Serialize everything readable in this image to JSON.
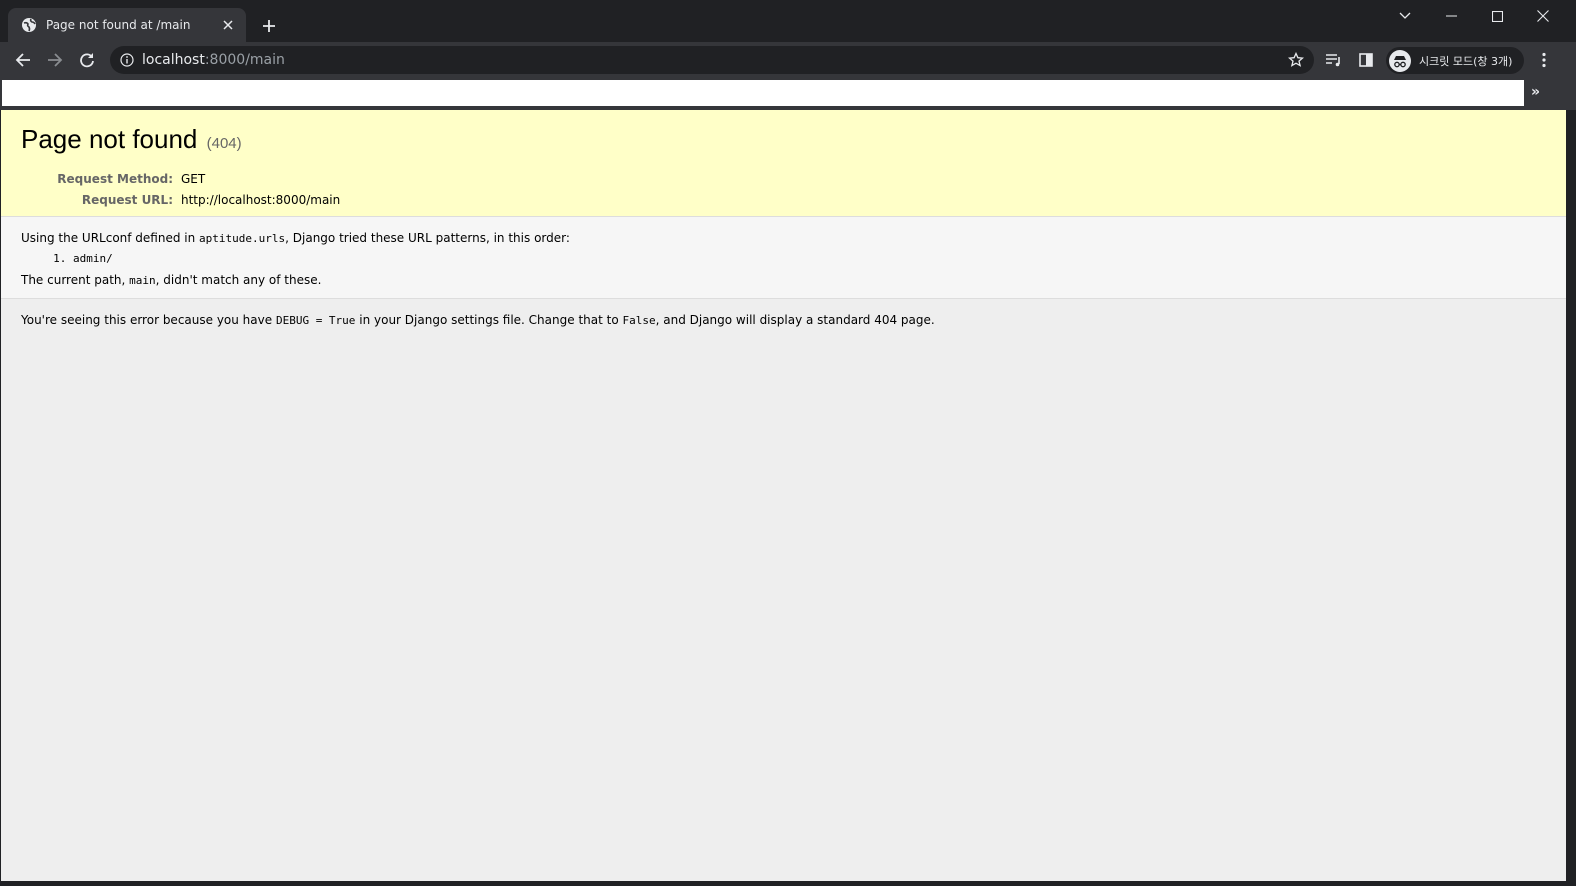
{
  "browser": {
    "tab": {
      "title": "Page not found at /main"
    },
    "address": {
      "host": "localhost",
      "rest": ":8000/main"
    },
    "profile": {
      "label": "시크릿 모드(창 3개)"
    },
    "bookmarks_chevron": "»",
    "icons": [
      "globe-icon",
      "close-icon",
      "plus-icon",
      "chevron-down-icon",
      "minimize-icon",
      "maximize-icon",
      "window-close-icon",
      "back-arrow-icon",
      "forward-arrow-icon",
      "reload-icon",
      "info-icon",
      "star-icon",
      "media-queue-icon",
      "side-panel-icon",
      "incognito-icon",
      "more-vert-icon"
    ]
  },
  "page": {
    "title": "Page not found",
    "status_code": "(404)",
    "request_method_label": "Request Method:",
    "request_method": "GET",
    "request_url_label": "Request URL:",
    "request_url": "http://localhost:8000/main",
    "urlconf_prefix": "Using the URLconf defined in ",
    "urlconf_module": "aptitude.urls",
    "urlconf_suffix": ", Django tried these URL patterns, in this order:",
    "patterns": [
      "admin/"
    ],
    "current_path_prefix": "The current path, ",
    "current_path": "main",
    "current_path_suffix": ", didn't match any of these.",
    "explanation_prefix": "You're seeing this error because you have ",
    "debug_setting": "DEBUG = True",
    "explanation_middle": " in your Django settings file. Change that to ",
    "false_value": "False",
    "explanation_suffix": ", and Django will display a standard 404 page."
  },
  "colors": {
    "summary_bg": "#ffffc8",
    "info_bg": "#f6f6f6",
    "page_bg": "#eeeeee",
    "chrome_dark": "#202124",
    "chrome_toolbar": "#35363a"
  }
}
